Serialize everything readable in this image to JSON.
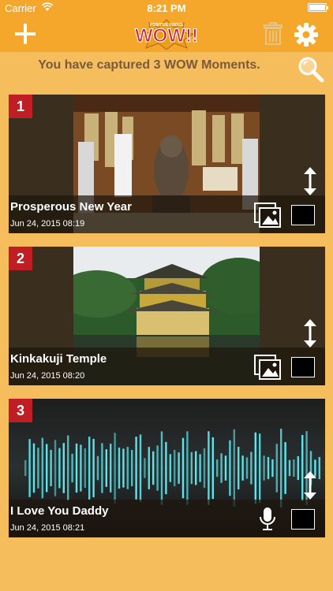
{
  "status": {
    "carrier": "Carrier",
    "time": "8:21 PM"
  },
  "header": {
    "logo_text": "WOW!!",
    "logo_subtext": "POSITIVE FOCUS"
  },
  "summary": "You have captured 3 WOW Moments.",
  "moments": [
    {
      "number": "1",
      "title": "Prosperous New Year",
      "date": "Jun 24, 2015 08:19",
      "media": "photo-icon"
    },
    {
      "number": "2",
      "title": "Kinkakuji Temple",
      "date": "Jun 24, 2015 08:20",
      "media": "photo-icon"
    },
    {
      "number": "3",
      "title": "I Love You Daddy",
      "date": "Jun 24, 2015 08:21",
      "media": "microphone-icon"
    }
  ],
  "icons": [
    "add-icon",
    "trash-icon",
    "gear-icon",
    "search-icon",
    "reorder-icon",
    "photo-icon",
    "microphone-icon"
  ],
  "colors": {
    "background": "#f6bd5c",
    "navbar": "#f4a72a",
    "badge": "#c01e25"
  }
}
